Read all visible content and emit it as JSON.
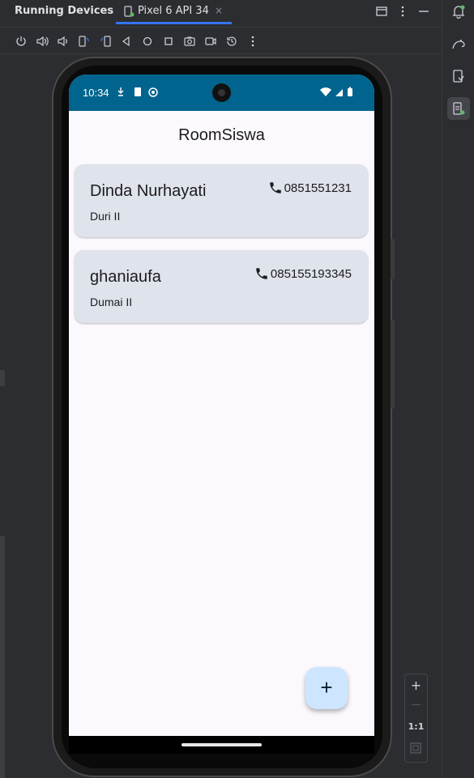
{
  "ide": {
    "tool_window_title": "Running Devices",
    "tab_label": "Pixel 6 API 34",
    "tab_close": "×",
    "zoom": {
      "in": "+",
      "out": "—",
      "actual": "1:1"
    }
  },
  "device": {
    "status_time": "10:34",
    "app_title": "RoomSiswa",
    "students": [
      {
        "name": "Dinda Nurhayati",
        "address": "Duri II",
        "phone": "0851551231"
      },
      {
        "name": "ghaniaufa",
        "address": "Dumai II",
        "phone": "085155193345"
      }
    ],
    "fab_label": "+",
    "colors": {
      "status_bar": "#01648e",
      "card": "#dfe3eb",
      "fab": "#cde5ff",
      "background": "#fbf9fd"
    }
  }
}
